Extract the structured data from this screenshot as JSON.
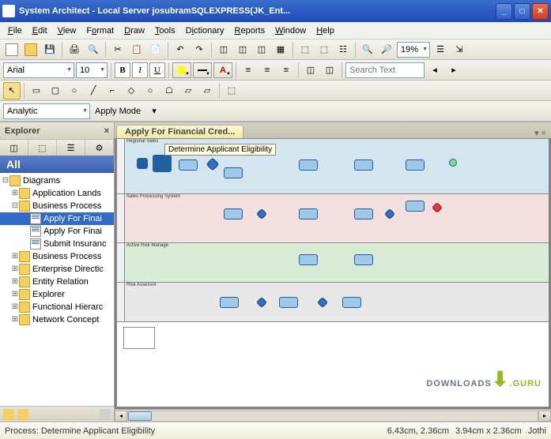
{
  "titlebar": {
    "app_name": "System Architect",
    "title_full": "System Architect - Local Server josubramSQLEXPRESS(JK_Ent..."
  },
  "menu": {
    "file": "File",
    "edit": "Edit",
    "view": "View",
    "format": "Format",
    "draw": "Draw",
    "tools": "Tools",
    "dictionary": "Dictionary",
    "reports": "Reports",
    "window": "Window",
    "help": "Help"
  },
  "toolbar1": {
    "zoom_value": "19%"
  },
  "toolbar2": {
    "font_name": "Arial",
    "font_size": "10",
    "search_placeholder": "Search Text"
  },
  "toolbar4": {
    "mode_name": "Analytic",
    "apply_label": "Apply Mode"
  },
  "explorer": {
    "title": "Explorer",
    "section": "All",
    "root": "Diagrams",
    "items": [
      "Application Lands",
      "Business Process"
    ],
    "bp_children": [
      "Apply For Finai",
      "Apply For Finai",
      "Submit Insuranc"
    ],
    "items_after": [
      "Business Process",
      "Enterprise Directic",
      "Entity Relation",
      "Explorer",
      "Functional Hierarc",
      "Network Concept"
    ]
  },
  "document": {
    "tab_title": "Apply For Financial Cred...",
    "tooltip": "Determine Applicant Eligibility",
    "lanes": [
      "Regional Sales",
      "Sales Processing System",
      "Active Risk Manage",
      "Risk Assessor"
    ]
  },
  "statusbar": {
    "left": "Process: Determine Applicant Eligibility",
    "coords": "6.43cm, 2.36cm",
    "size": "3.94cm x 2.36cm",
    "user": "Jothi"
  },
  "watermark": {
    "text1": "DOWNLOADS",
    "text2": ".GURU"
  }
}
